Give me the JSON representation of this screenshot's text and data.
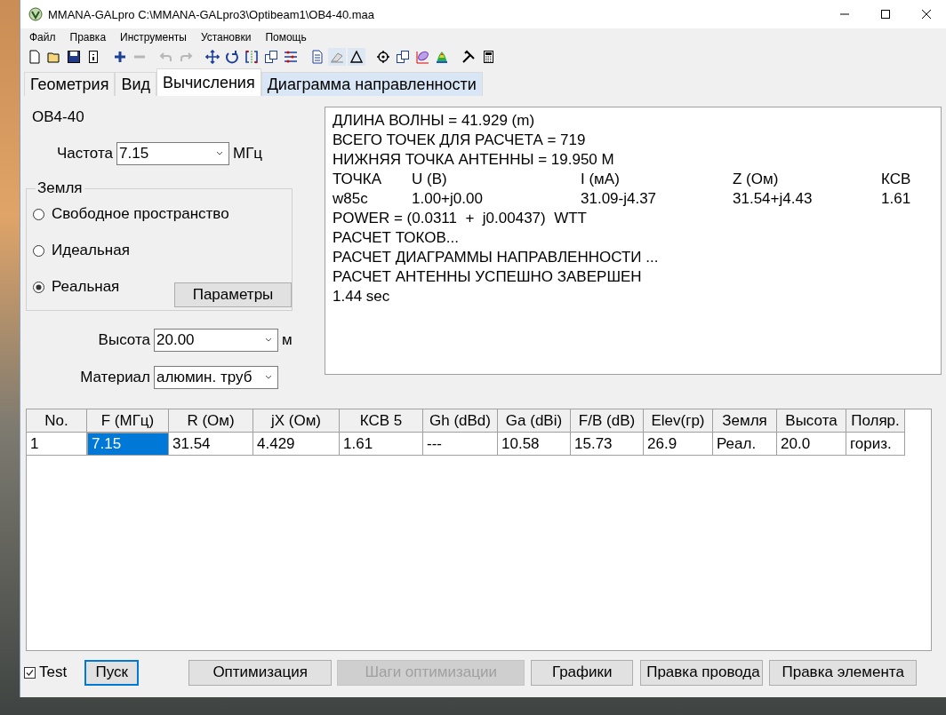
{
  "window": {
    "title": "MMANA-GALpro C:\\MMANA-GALpro3\\Optibeam1\\OB4-40.maa"
  },
  "menu": [
    "Файл",
    "Правка",
    "Инструменты",
    "Установки",
    "Помощь"
  ],
  "toolbar": [
    {
      "kind": "new",
      "disabled": false,
      "pressed": false
    },
    {
      "kind": "open",
      "disabled": false,
      "pressed": false
    },
    {
      "kind": "save",
      "disabled": false,
      "pressed": false
    },
    {
      "kind": "info",
      "disabled": false,
      "pressed": false
    },
    {
      "kind": "sep"
    },
    {
      "kind": "plus",
      "disabled": false,
      "pressed": false
    },
    {
      "kind": "minus",
      "disabled": true,
      "pressed": false
    },
    {
      "kind": "sep"
    },
    {
      "kind": "undo",
      "disabled": true,
      "pressed": false
    },
    {
      "kind": "redo",
      "disabled": true,
      "pressed": false
    },
    {
      "kind": "sep"
    },
    {
      "kind": "move",
      "disabled": false,
      "pressed": false
    },
    {
      "kind": "rotate",
      "disabled": false,
      "pressed": false
    },
    {
      "kind": "bracket",
      "disabled": false,
      "pressed": false
    },
    {
      "kind": "copy",
      "disabled": false,
      "pressed": false
    },
    {
      "kind": "lines",
      "disabled": false,
      "pressed": false
    },
    {
      "kind": "sep"
    },
    {
      "kind": "page",
      "disabled": false,
      "pressed": false
    },
    {
      "kind": "eraser",
      "disabled": false,
      "pressed": true
    },
    {
      "kind": "triangle",
      "disabled": false,
      "pressed": true
    },
    {
      "kind": "sep"
    },
    {
      "kind": "target",
      "disabled": false,
      "pressed": false
    },
    {
      "kind": "copy",
      "disabled": false,
      "pressed": false
    },
    {
      "kind": "lobe",
      "disabled": false,
      "pressed": false
    },
    {
      "kind": "heat",
      "disabled": false,
      "pressed": false
    },
    {
      "kind": "sep"
    },
    {
      "kind": "tools",
      "disabled": false,
      "pressed": false
    },
    {
      "kind": "calc",
      "disabled": false,
      "pressed": false
    }
  ],
  "tabs": [
    {
      "label": "Геометрия",
      "selected": false
    },
    {
      "label": "Вид",
      "selected": false
    },
    {
      "label": "Вычисления",
      "selected": true
    },
    {
      "label": "Диаграмма направленности",
      "selected": false,
      "highlighted": true
    }
  ],
  "antenna_name": "OB4-40",
  "frequency": {
    "label": "Частота",
    "value": "7.15",
    "unit": "МГц"
  },
  "ground": {
    "title": "Земля",
    "options": [
      {
        "label": "Свободное пространство",
        "selected": false
      },
      {
        "label": "Идеальная",
        "selected": false
      },
      {
        "label": "Реальная",
        "selected": true
      }
    ],
    "button": "Параметры"
  },
  "height": {
    "label": "Высота",
    "value": "20.00",
    "unit": "м"
  },
  "material": {
    "label": "Материал",
    "value": "алюмин. труб"
  },
  "output": [
    {
      "kind": "text",
      "text": "ДЛИНА ВОЛНЫ = 41.929 (m)"
    },
    {
      "kind": "text",
      "text": "ВСЕГО ТОЧЕК ДЛЯ РАСЧЕТА = 719"
    },
    {
      "kind": "text",
      "text": "НИЖНЯЯ ТОЧКА АНТЕННЫ = 19.950 М"
    },
    {
      "kind": "columns",
      "cells": [
        "ТОЧКА",
        "U (B)",
        "I (мА)",
        "Z (Ом)",
        "КСВ"
      ]
    },
    {
      "kind": "columns",
      "cells": [
        "w85c",
        "1.00+j0.00",
        "31.09-j4.37",
        "31.54+j4.43",
        "1.61"
      ]
    },
    {
      "kind": "text",
      "text": "POWER = (0.0311  +  j0.00437)  WTT"
    },
    {
      "kind": "text",
      "text": "РАСЧЕТ ТОКОВ..."
    },
    {
      "kind": "text",
      "text": "РАСЧЕТ ДИАГРАММЫ НАПРАВЛЕННОСТИ ..."
    },
    {
      "kind": "text",
      "text": "РАСЧЕТ АНТЕННЫ УСПЕШНО ЗАВЕРШЕН"
    },
    {
      "kind": "text",
      "text": "1.44 sec"
    }
  ],
  "table": {
    "columns": [
      "No.",
      "F (МГц)",
      "R (Ом)",
      "jX (Ом)",
      "КСВ 5",
      "Gh (dBd)",
      "Ga (dBi)",
      "F/B (dB)",
      "Elev(гр)",
      "Земля",
      "Высота",
      "Поляр."
    ],
    "rows": [
      {
        "cells": [
          {
            "text": "1",
            "selected": false
          },
          {
            "text": "7.15",
            "selected": true
          },
          {
            "text": "31.54",
            "selected": false
          },
          {
            "text": "4.429",
            "selected": false
          },
          {
            "text": "1.61",
            "selected": false
          },
          {
            "text": "---",
            "selected": false
          },
          {
            "text": "10.58",
            "selected": false
          },
          {
            "text": "15.73",
            "selected": false
          },
          {
            "text": "26.9",
            "selected": false
          },
          {
            "text": "Реал.",
            "selected": false
          },
          {
            "text": "20.0",
            "selected": false
          },
          {
            "text": "гориз.",
            "selected": false
          }
        ]
      }
    ]
  },
  "test": {
    "label": "Test",
    "checked": true
  },
  "buttons": [
    {
      "label": "Пуск",
      "focused": true,
      "disabled": false
    },
    {
      "label": "Оптимизация",
      "focused": false,
      "disabled": false
    },
    {
      "label": "Шаги оптимизации",
      "focused": false,
      "disabled": true
    },
    {
      "label": "Графики",
      "focused": false,
      "disabled": false
    },
    {
      "label": "Правка провода",
      "focused": false,
      "disabled": false
    },
    {
      "label": "Правка элемента",
      "focused": false,
      "disabled": false
    }
  ]
}
